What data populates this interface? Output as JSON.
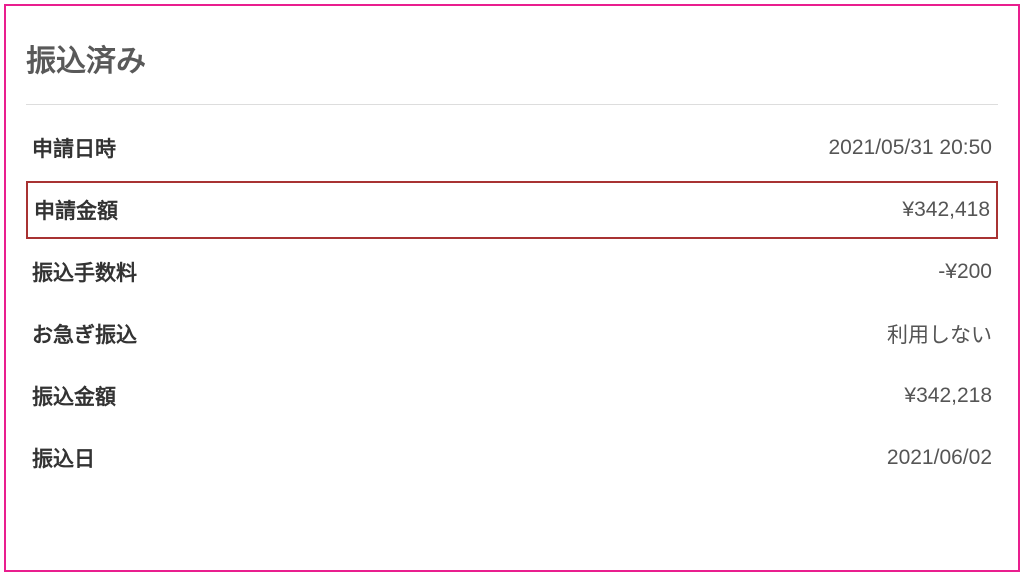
{
  "title": "振込済み",
  "rows": {
    "applied_at": {
      "label": "申請日時",
      "value": "2021/05/31 20:50"
    },
    "applied_amount": {
      "label": "申請金額",
      "value": "¥342,418"
    },
    "transfer_fee": {
      "label": "振込手数料",
      "value": "-¥200"
    },
    "express_transfer": {
      "label": "お急ぎ振込",
      "value": "利用しない"
    },
    "transfer_amount": {
      "label": "振込金額",
      "value": "¥342,218"
    },
    "transfer_date": {
      "label": "振込日",
      "value": "2021/06/02"
    }
  }
}
